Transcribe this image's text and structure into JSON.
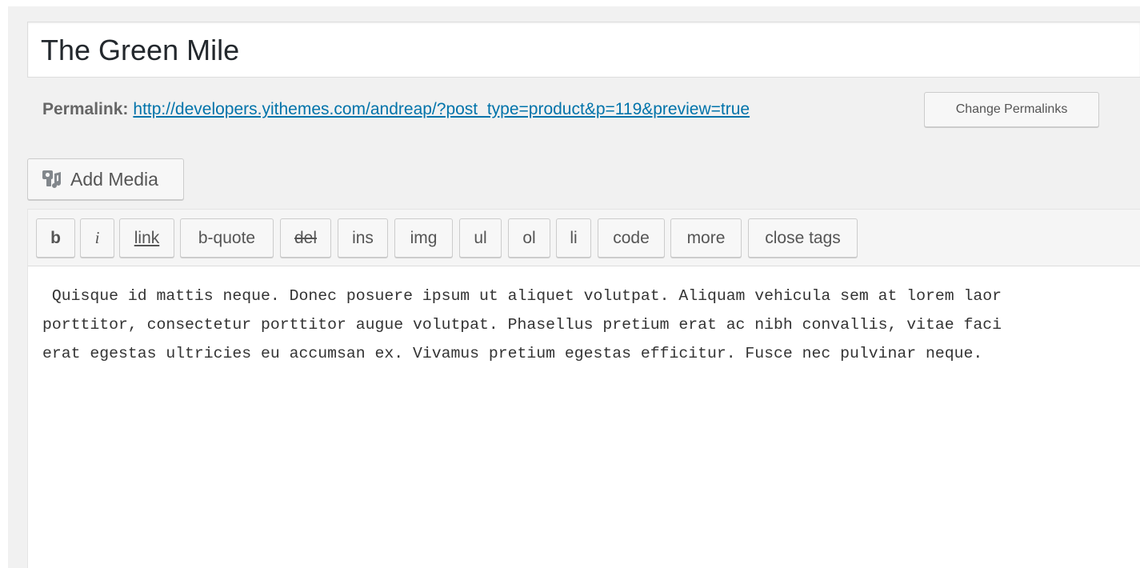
{
  "post": {
    "title": "The Green Mile"
  },
  "permalink": {
    "label": "Permalink:",
    "url": "http://developers.yithemes.com/andreap/?post_type=product&p=119&preview=true",
    "change_button": "Change Permalinks"
  },
  "media": {
    "add_media_label": "Add Media",
    "icon": "add-media-icon"
  },
  "quicktags": [
    {
      "key": "b",
      "label": "b"
    },
    {
      "key": "i",
      "label": "i"
    },
    {
      "key": "link",
      "label": "link"
    },
    {
      "key": "b-quote",
      "label": "b-quote"
    },
    {
      "key": "del",
      "label": "del"
    },
    {
      "key": "ins",
      "label": "ins"
    },
    {
      "key": "img",
      "label": "img"
    },
    {
      "key": "ul",
      "label": "ul"
    },
    {
      "key": "ol",
      "label": "ol"
    },
    {
      "key": "li",
      "label": "li"
    },
    {
      "key": "code",
      "label": "code"
    },
    {
      "key": "more",
      "label": "more"
    },
    {
      "key": "close-tags",
      "label": "close tags"
    }
  ],
  "editor": {
    "lines": [
      " Quisque id mattis neque. Donec posuere ipsum ut aliquet volutpat. Aliquam vehicula sem at lorem laor",
      "porttitor, consectetur porttitor augue volutpat. Phasellus pretium erat ac nibh convallis, vitae faci",
      "erat egestas ultricies eu accumsan ex. Vivamus pretium egestas efficitur. Fusce nec pulvinar neque."
    ]
  },
  "colors": {
    "link": "#0073aa",
    "button_bg": "#f7f7f7",
    "page_bg": "#f1f1f1"
  }
}
